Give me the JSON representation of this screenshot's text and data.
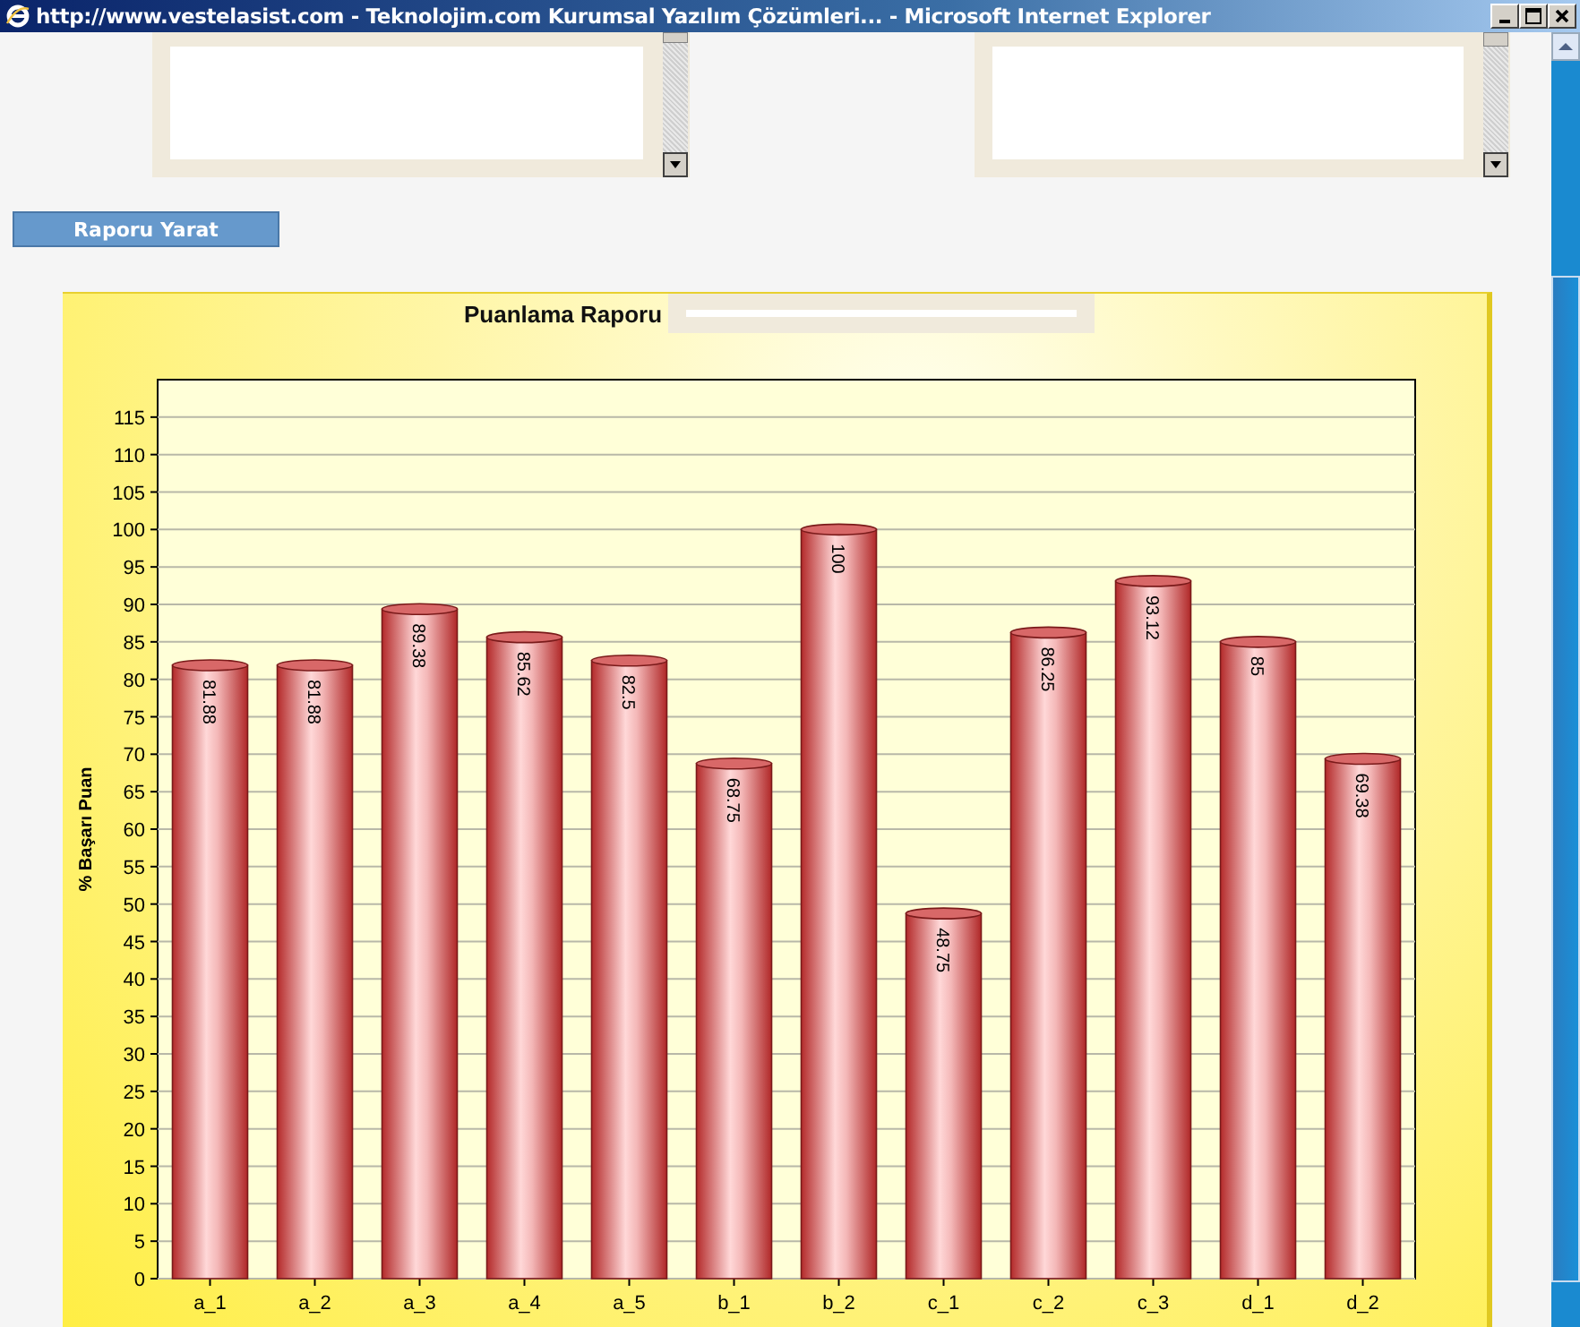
{
  "window": {
    "title": "http://www.vestelasist.com - Teknolojim.com Kurumsal Yazılım Çözümleri... - Microsoft Internet Explorer"
  },
  "button": {
    "label": "Raporu Yarat"
  },
  "report": {
    "title": "Puanlama Raporu",
    "chart_data": {
      "type": "bar",
      "ylabel": "% Başarı Puan",
      "categories": [
        "a_1",
        "a_2",
        "a_3",
        "a_4",
        "a_5",
        "b_1",
        "b_2",
        "c_1",
        "c_2",
        "c_3",
        "d_1",
        "d_2"
      ],
      "values": [
        81.88,
        81.88,
        89.38,
        85.62,
        82.5,
        68.75,
        100,
        48.75,
        86.25,
        93.12,
        85,
        69.38
      ],
      "ylim": [
        0,
        120
      ],
      "grid": true,
      "yticks": [
        0,
        5,
        10,
        15,
        20,
        25,
        30,
        35,
        40,
        45,
        50,
        55,
        60,
        65,
        70,
        75,
        80,
        85,
        90,
        95,
        100,
        105,
        110,
        115
      ],
      "data_labels": true
    }
  }
}
